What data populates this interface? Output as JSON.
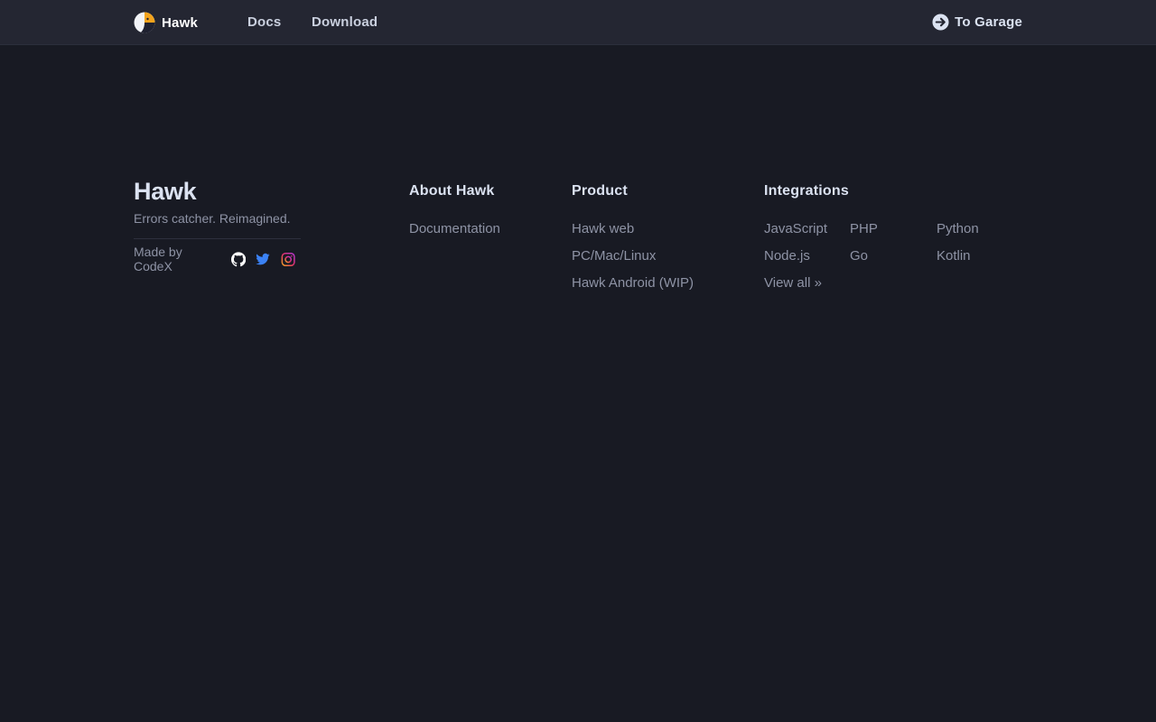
{
  "header": {
    "brand_name": "Hawk",
    "nav": [
      {
        "label": "Docs"
      },
      {
        "label": "Download"
      }
    ],
    "garage_label": "To Garage"
  },
  "footer": {
    "title": "Hawk",
    "tagline": "Errors catcher. Reimagined.",
    "made_by": "Made by CodeX",
    "social_icons": [
      "github-icon",
      "twitter-icon",
      "instagram-icon"
    ],
    "columns": {
      "about": {
        "title": "About Hawk",
        "links": [
          "Documentation"
        ]
      },
      "product": {
        "title": "Product",
        "links": [
          "Hawk web",
          "PC/Mac/Linux",
          "Hawk Android (WIP)"
        ]
      },
      "integrations": {
        "title": "Integrations",
        "links": [
          "JavaScript",
          "PHP",
          "Python",
          "Node.js",
          "Go",
          "Kotlin",
          "View all »"
        ]
      }
    }
  },
  "colors": {
    "background": "#181a23",
    "header_background": "#242632",
    "text_primary": "#dbe2f1",
    "text_muted": "#8e93a5",
    "twitter_blue": "#3b82f6",
    "instagram_pink": "#d6479b"
  }
}
